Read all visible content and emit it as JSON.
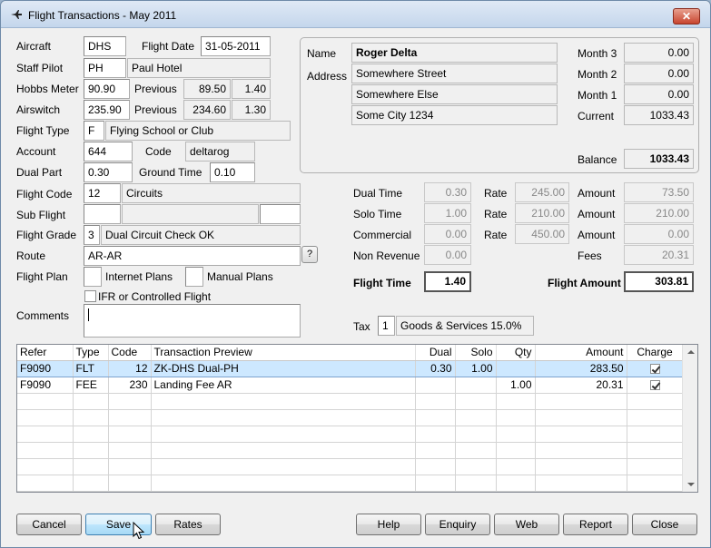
{
  "window": {
    "title": "Flight Transactions - May 2011",
    "close_glyph": "✕"
  },
  "form": {
    "aircraft": {
      "label": "Aircraft",
      "value": "DHS"
    },
    "flight_date": {
      "label": "Flight Date",
      "value": "31-05-2011"
    },
    "staff_pilot": {
      "label": "Staff Pilot",
      "code": "PH",
      "name": "Paul Hotel"
    },
    "hobbs_meter": {
      "label": "Hobbs Meter",
      "value": "90.90",
      "previous_label": "Previous",
      "previous": "89.50",
      "diff": "1.40"
    },
    "airswitch": {
      "label": "Airswitch",
      "value": "235.90",
      "previous_label": "Previous",
      "previous": "234.60",
      "diff": "1.30"
    },
    "flight_type": {
      "label": "Flight Type",
      "code": "F",
      "name": "Flying School or Club"
    },
    "account": {
      "label": "Account",
      "value": "644",
      "code_label": "Code",
      "code": "deltarog"
    },
    "dual_part": {
      "label": "Dual Part",
      "value": "0.30",
      "ground_time_label": "Ground Time",
      "ground_time": "0.10"
    },
    "flight_code": {
      "label": "Flight Code",
      "code": "12",
      "name": "Circuits"
    },
    "sub_flight": {
      "label": "Sub Flight",
      "code": "",
      "name": "",
      "extra": ""
    },
    "flight_grade": {
      "label": "Flight Grade",
      "code": "3",
      "name": "Dual Circuit Check OK"
    },
    "route": {
      "label": "Route",
      "value": "AR-AR",
      "button": "?"
    },
    "flight_plan": {
      "label": "Flight Plan",
      "internet_label": "Internet Plans",
      "manual_label": "Manual Plans"
    },
    "ifr": {
      "label": "IFR or Controlled Flight"
    },
    "comments": {
      "label": "Comments",
      "value": ""
    }
  },
  "member": {
    "name_label": "Name",
    "name": "Roger Delta",
    "address_label": "Address",
    "address": [
      "Somewhere Street",
      "Somewhere Else",
      "Some City 1234"
    ],
    "months": [
      {
        "label": "Month 3",
        "value": "0.00"
      },
      {
        "label": "Month 2",
        "value": "0.00"
      },
      {
        "label": "Month 1",
        "value": "0.00"
      },
      {
        "label": "Current",
        "value": "1033.43"
      }
    ],
    "balance_label": "Balance",
    "balance": "1033.43"
  },
  "charges": {
    "rows": [
      {
        "label": "Dual Time",
        "time": "0.30",
        "rate_label": "Rate",
        "rate": "245.00",
        "amount_label": "Amount",
        "amount": "73.50"
      },
      {
        "label": "Solo Time",
        "time": "1.00",
        "rate_label": "Rate",
        "rate": "210.00",
        "amount_label": "Amount",
        "amount": "210.00"
      },
      {
        "label": "Commercial",
        "time": "0.00",
        "rate_label": "Rate",
        "rate": "450.00",
        "amount_label": "Amount",
        "amount": "0.00"
      }
    ],
    "non_revenue_label": "Non Revenue",
    "non_revenue": "0.00",
    "fees_label": "Fees",
    "fees": "20.31",
    "flight_time_label": "Flight Time",
    "flight_time": "1.40",
    "flight_amount_label": "Flight Amount",
    "flight_amount": "303.81",
    "tax_label": "Tax",
    "tax_code": "1",
    "tax_name": "Goods & Services 15.0%"
  },
  "transactions": {
    "columns": [
      "Refer",
      "Type",
      "Code",
      "Transaction Preview",
      "Dual",
      "Solo",
      "Qty",
      "Amount",
      "Charge"
    ],
    "rows": [
      {
        "refer": "F9090",
        "type": "FLT",
        "code": "12",
        "preview": "ZK-DHS Dual-PH",
        "dual": "0.30",
        "solo": "1.00",
        "qty": "",
        "amount": "283.50",
        "charge": true
      },
      {
        "refer": "F9090",
        "type": "FEE",
        "code": "230",
        "preview": "Landing Fee AR",
        "dual": "",
        "solo": "",
        "qty": "1.00",
        "amount": "20.31",
        "charge": true
      }
    ]
  },
  "buttons": {
    "cancel": "Cancel",
    "save": "Save",
    "rates": "Rates",
    "help": "Help",
    "enquiry": "Enquiry",
    "web": "Web",
    "report": "Report",
    "close": "Close"
  }
}
